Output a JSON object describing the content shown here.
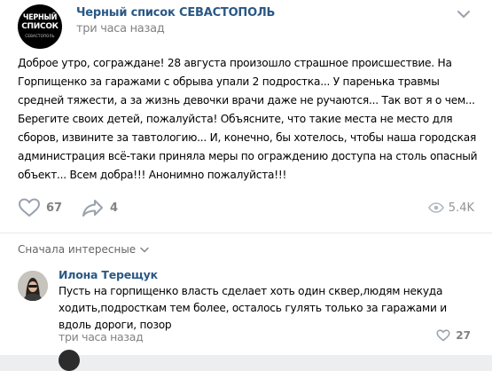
{
  "post": {
    "avatar_lines": [
      "ЧЕРНЫЙ",
      "СПИСОК",
      "СЕВАСТОПОЛЬ"
    ],
    "group_name": "Черный список СЕВАСТОПОЛЬ",
    "time": "три часа назад",
    "text": "Доброе утро, сограждане! 28 августа произошло страшное происшествие. На\nГорпищенко за гаражами с обрыва упали 2 подростка... У паренька травмы\nсредней тяжести, а за жизнь девочки врачи даже не ручаются... Так вот я о чем...\nБерегите своих детей, пожалуйста! Объясните, что такие места не место для\nсборов, извините за тавтологию... И, конечно, бы хотелось, чтобы наша городская\nадминистрация всё-таки приняла меры по ограждению доступа на столь опасный\nобъект... Всем добра!!! Анонимно пожалуйста!!!",
    "likes": "67",
    "shares": "4",
    "views": "5.4K"
  },
  "comments": {
    "sort_label": "Сначала интересные",
    "items": [
      {
        "author": "Илона Терещук",
        "text": "Пусть на горпищенко власть сделает хоть один сквер,людям некуда ходить,подросткам тем более, осталось гулять только за гаражами и вдоль дороги, позор",
        "time": "три часа назад",
        "likes": "27"
      }
    ]
  },
  "icons": {
    "like": "heart-icon",
    "share": "share-arrow-icon",
    "views": "eye-icon",
    "menu": "chevron-down-icon",
    "sort": "chevron-down-icon"
  },
  "colors": {
    "link": "#2a5885",
    "muted": "#828282",
    "icon": "#99a2ad"
  }
}
